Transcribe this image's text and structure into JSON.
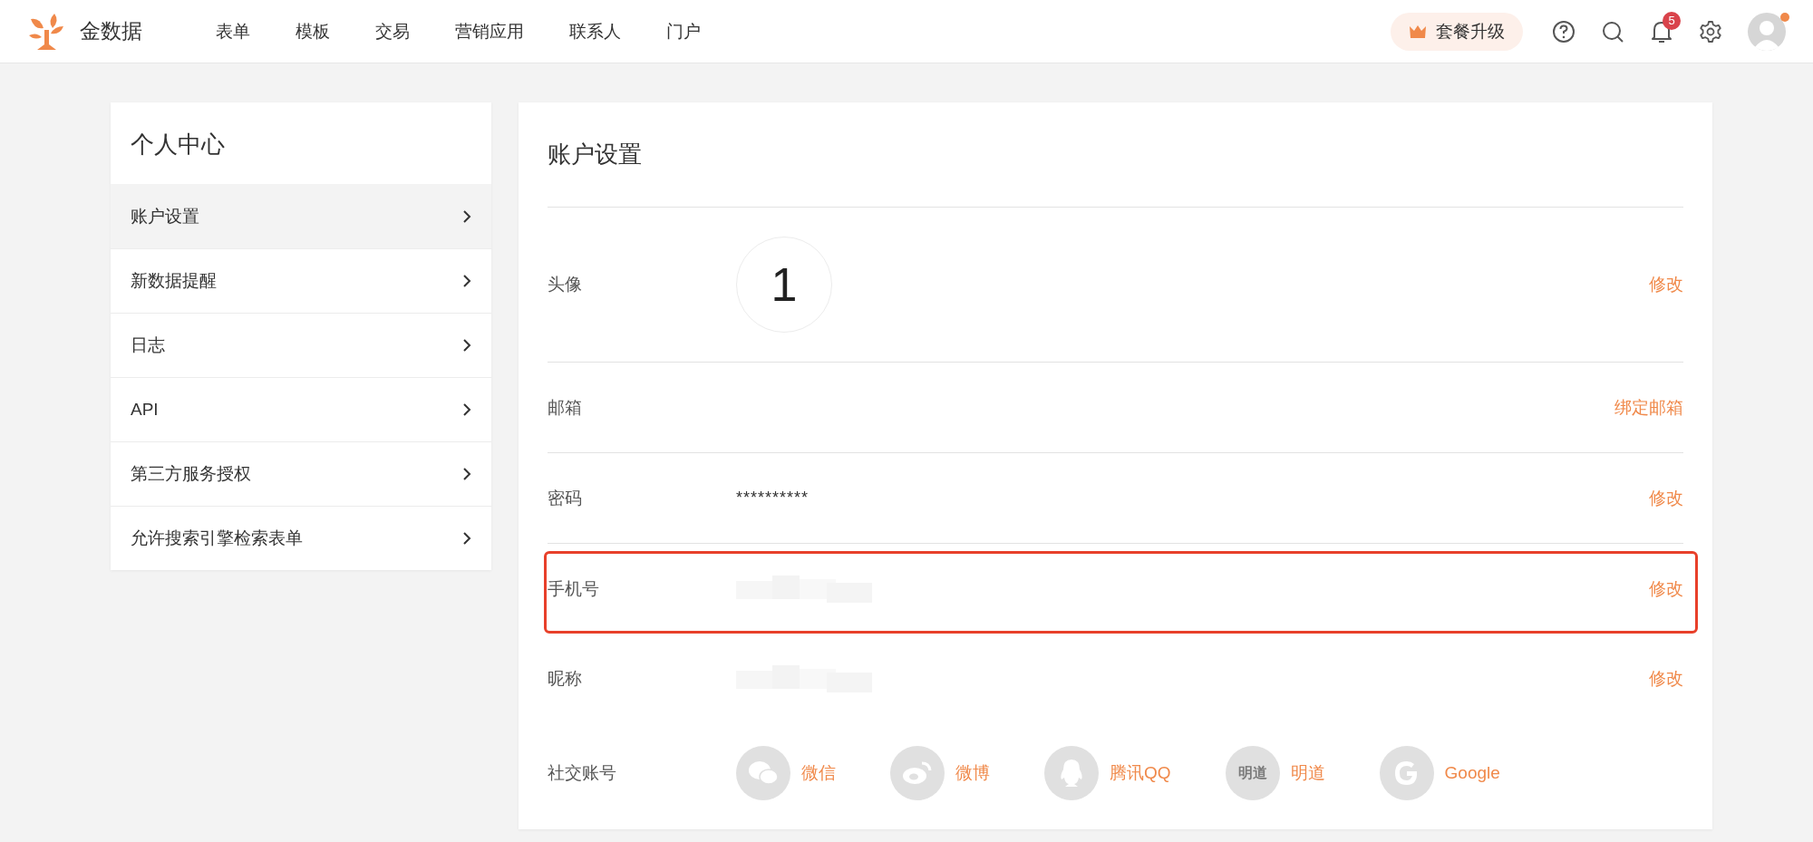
{
  "header": {
    "brand": "金数据",
    "nav": [
      {
        "label": "表单",
        "selected": false
      },
      {
        "label": "模板",
        "selected": false
      },
      {
        "label": "交易",
        "selected": false
      },
      {
        "label": "营销应用",
        "selected": false
      },
      {
        "label": "联系人",
        "selected": false
      },
      {
        "label": "门户",
        "selected": false
      }
    ],
    "upgrade": "套餐升级",
    "notification_count": "5",
    "avatar_dot": true
  },
  "sidebar": {
    "title": "个人中心",
    "items": [
      {
        "label": "账户设置",
        "selected": true
      },
      {
        "label": "新数据提醒",
        "selected": false
      },
      {
        "label": "日志",
        "selected": false
      },
      {
        "label": "API",
        "selected": false
      },
      {
        "label": "第三方服务授权",
        "selected": false
      },
      {
        "label": "允许搜索引擎检索表单",
        "selected": false
      }
    ]
  },
  "main": {
    "title": "账户设置",
    "rows": [
      {
        "kind": "avatar",
        "label": "头像",
        "value": "1",
        "action": "修改",
        "highlighted": false
      },
      {
        "kind": "text",
        "label": "邮箱",
        "action": "绑定邮箱",
        "highlighted": false
      },
      {
        "kind": "text",
        "label": "密码",
        "value": "**********",
        "action": "修改",
        "highlighted": false
      },
      {
        "kind": "blurred",
        "label": "手机号",
        "action": "修改",
        "highlighted": true
      },
      {
        "kind": "blurred",
        "label": "昵称",
        "action": "修改",
        "highlighted": false
      },
      {
        "kind": "social",
        "label": "社交账号",
        "accounts": [
          {
            "kind": "wechat",
            "label": "微信"
          },
          {
            "kind": "weibo",
            "label": "微博"
          },
          {
            "kind": "qq",
            "label": "腾讯QQ"
          },
          {
            "kind": "mingdao",
            "label": "明道",
            "icon_text": "明道"
          },
          {
            "kind": "google",
            "label": "Google"
          }
        ]
      }
    ]
  }
}
